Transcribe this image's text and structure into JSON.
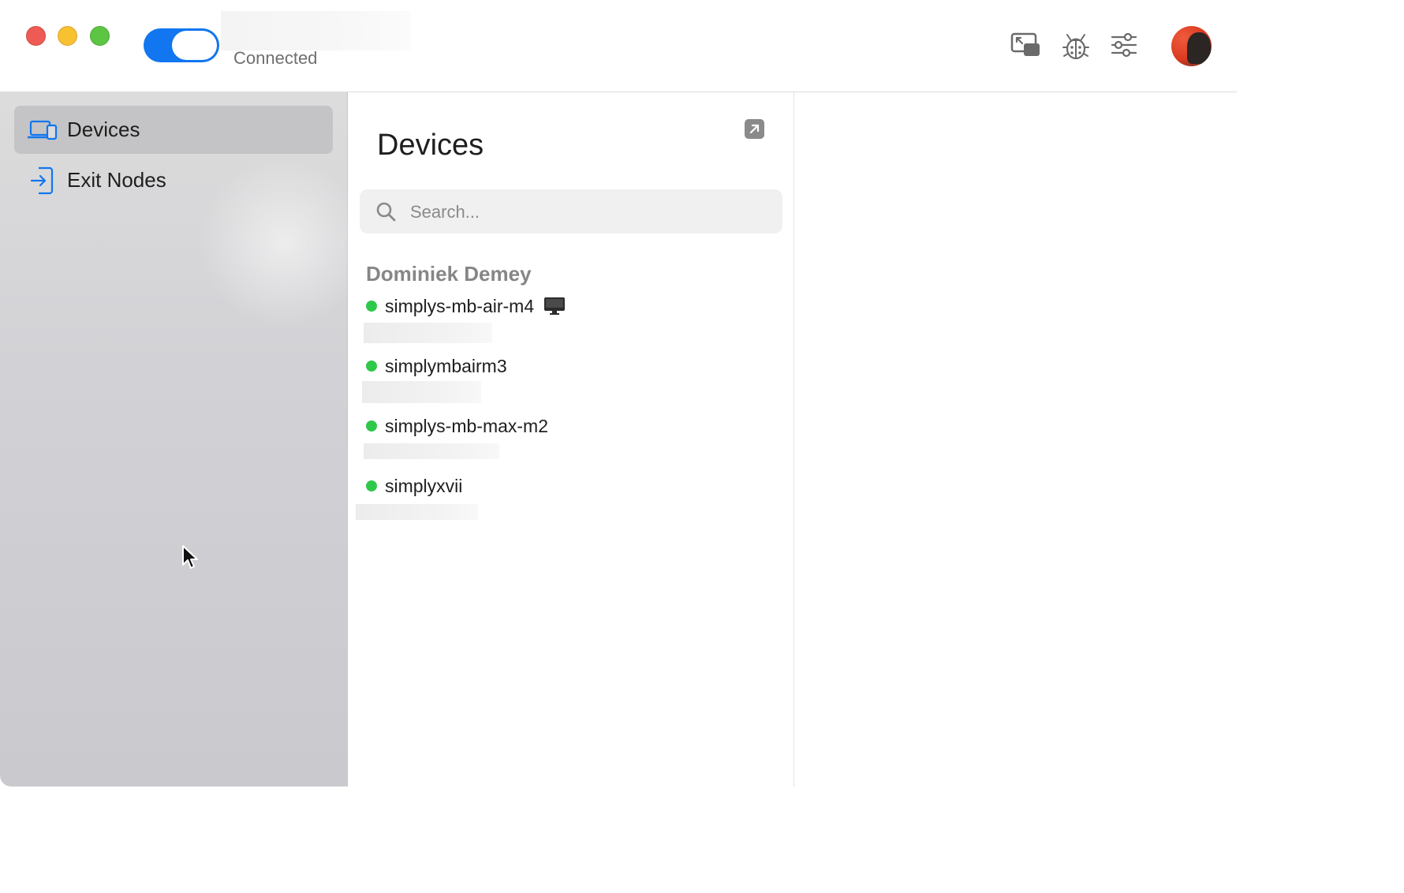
{
  "titlebar": {
    "connection_status": "Connected",
    "toggle_on": true,
    "toolbar_icons": [
      "picture-in-picture-icon",
      "bug-icon",
      "sliders-icon"
    ]
  },
  "sidebar": {
    "items": [
      {
        "label": "Devices",
        "icon": "devices-icon",
        "active": true
      },
      {
        "label": "Exit Nodes",
        "icon": "exit-node-icon",
        "active": false
      }
    ]
  },
  "devices_panel": {
    "title": "Devices",
    "search_placeholder": "Search...",
    "owner": "Dominiek Demey",
    "devices": [
      {
        "name": "simplys-mb-air-m4",
        "online": true,
        "this_device": true
      },
      {
        "name": "simplymbairm3",
        "online": true
      },
      {
        "name": "simplys-mb-max-m2",
        "online": true
      },
      {
        "name": "simplyxvii",
        "online": true
      }
    ]
  },
  "colors": {
    "accent": "#1176ef",
    "online": "#30c84a",
    "close": "#ee5b54",
    "minimize": "#f7c132",
    "maximize": "#5dc544"
  }
}
